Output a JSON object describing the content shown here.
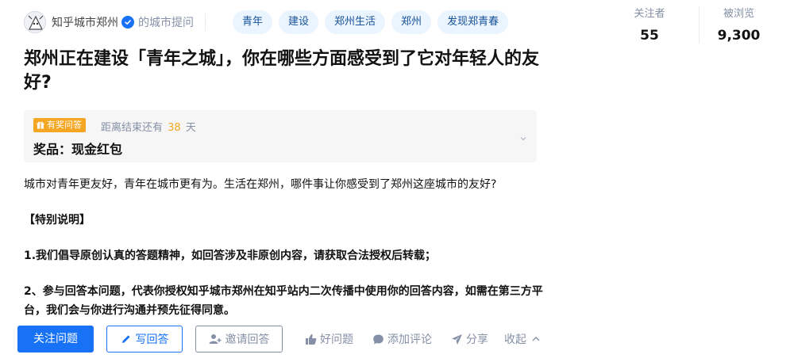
{
  "asker": {
    "name": "知乎城市郑州",
    "suffix": "的城市提问"
  },
  "tags": [
    "青年",
    "建设",
    "郑州生活",
    "郑州",
    "发现郑青春"
  ],
  "stats": {
    "followers_label": "关注者",
    "followers_value": "55",
    "views_label": "被浏览",
    "views_value": "9,300"
  },
  "question": {
    "title": "郑州正在建设「青年之城」，你在哪些方面感受到了它对年轻人的友好?"
  },
  "reward": {
    "badge": "有奖问答",
    "deadline_prefix": "距离结束还有",
    "deadline_days": "38",
    "deadline_unit": "天",
    "prize": "奖品：现金红包"
  },
  "description": {
    "intro": "城市对青年更友好，青年在城市更有为。生活在郑州，哪件事让你感受到了郑州这座城市的友好?",
    "heading": "【特别说明】",
    "item1": "1.我们倡导原创认真的答题精神，如回答涉及非原创内容，请获取合法授权后转载；",
    "item2": "2、参与回答本问题，代表你授权知乎城市郑州在知乎站内二次传播中使用你的回答内容，如需在第三方平台，我们会与你进行沟通并预先征得同意。"
  },
  "actions": {
    "follow": "关注问题",
    "write": "写回答",
    "invite": "邀请回答",
    "good_question": "好问题",
    "comment": "添加评论",
    "share": "分享",
    "collapse": "收起"
  },
  "colors": {
    "brand_blue": "#1772f6",
    "tag_bg": "#ebf5ff",
    "tag_text": "#175199",
    "reward_orange": "#f5a623",
    "muted_gray": "#8590a6"
  }
}
